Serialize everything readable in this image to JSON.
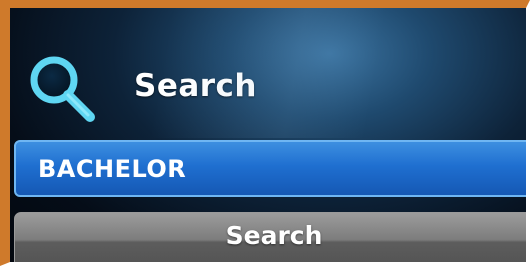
{
  "header": {
    "title": "Search",
    "icon": "search-icon"
  },
  "search": {
    "value": "BACHELOR"
  },
  "search_button": {
    "label": "Search"
  },
  "colors": {
    "frame_border": "#cf7a2b",
    "field_blue": "#1f6fd0",
    "icon_cyan": "#5fd6f2",
    "button_gray": "#7c7c7c"
  }
}
